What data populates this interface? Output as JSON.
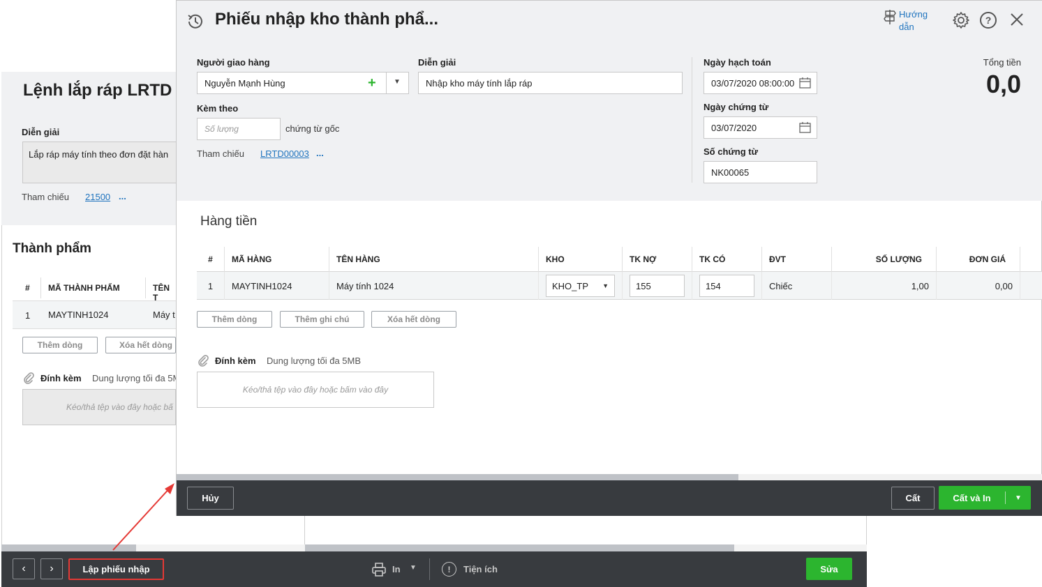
{
  "background_window": {
    "title": "Lệnh lắp ráp LRTD",
    "description_label": "Diễn giải",
    "description_value": "Lắp ráp máy tính theo đơn đặt hàn",
    "reference_label": "Tham chiếu",
    "reference_link": "21500",
    "reference_more": "...",
    "section_title": "Thành phẩm",
    "table": {
      "headers": [
        "#",
        "MÃ THÀNH PHẨM",
        "TÊN T"
      ],
      "rows": [
        [
          "1",
          "MAYTINH1024",
          "Máy t"
        ]
      ]
    },
    "add_row_button": "Thêm dòng",
    "delete_all_button": "Xóa hết dòng",
    "attach_label": "Đính kèm",
    "attach_limit": "Dung lượng tối đa 5M",
    "drop_text": "Kéo/thả tệp vào đây hoặc bấ",
    "toolbar": {
      "create_receipt_button": "Lập phiếu nhập",
      "print_label": "In",
      "utility_label": "Tiện ích",
      "edit_button": "Sửa"
    }
  },
  "dialog": {
    "title": "Phiếu nhập kho thành phẩ...",
    "guide_label_line1": "Hướng",
    "guide_label_line2": "dẫn",
    "deliverer_label": "Người giao hàng",
    "deliverer_value": "Nguyễn Mạnh Hùng",
    "description_label": "Diễn giải",
    "description_value": "Nhập kho máy tính lắp ráp",
    "attached_label": "Kèm theo",
    "attached_placeholder": "Số lượng",
    "attached_suffix": "chứng từ gốc",
    "reference_label": "Tham chiếu",
    "reference_link": "LRTD00003",
    "reference_more": "...",
    "posting_date_label": "Ngày hạch toán",
    "posting_date_value": "03/07/2020 08:00:00",
    "voucher_date_label": "Ngày chứng từ",
    "voucher_date_value": "03/07/2020",
    "voucher_no_label": "Số chứng từ",
    "voucher_no_value": "NK00065",
    "total_label": "Tổng tiền",
    "total_value": "0,0",
    "section_title": "Hàng tiền",
    "table": {
      "headers": [
        "#",
        "MÃ HÀNG",
        "TÊN HÀNG",
        "KHO",
        "TK NỢ",
        "TK CÓ",
        "ĐVT",
        "SỐ LƯỢNG",
        "ĐƠN GIÁ"
      ],
      "rows": [
        {
          "index": "1",
          "code": "MAYTINH1024",
          "name": "Máy tính 1024",
          "warehouse": "KHO_TP",
          "debit": "155",
          "credit": "154",
          "unit": "Chiếc",
          "quantity": "1,00",
          "price": "0,00"
        }
      ]
    },
    "add_row_button": "Thêm dòng",
    "add_note_button": "Thêm ghi chú",
    "delete_all_button": "Xóa hết dòng",
    "attach_label": "Đính kèm",
    "attach_limit": "Dung lượng tối đa 5MB",
    "drop_text": "Kéo/thả tệp vào đây hoặc bấm vào đây",
    "cancel_button": "Hủy",
    "save_button": "Cất",
    "save_print_button": "Cất và In"
  },
  "colors": {
    "primary_green": "#2cb52f",
    "link_blue": "#1e73be",
    "toolbar_dark": "#383b3f",
    "highlight_red": "#e53935"
  }
}
